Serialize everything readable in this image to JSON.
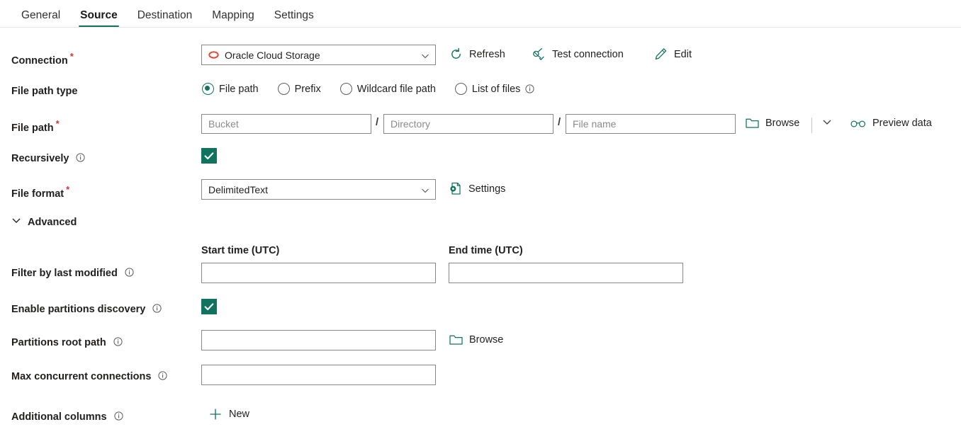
{
  "tabs": [
    {
      "label": "General",
      "active": false
    },
    {
      "label": "Source",
      "active": true
    },
    {
      "label": "Destination",
      "active": false
    },
    {
      "label": "Mapping",
      "active": false
    },
    {
      "label": "Settings",
      "active": false
    }
  ],
  "colors": {
    "accent_teal": "#107360",
    "required_red": "#d13438",
    "oracle_red": "#e8422e",
    "field_border": "#8a8886",
    "text": "#201f1e",
    "placeholder": "#8d8b89"
  },
  "connection": {
    "label": "Connection",
    "required": "*",
    "value": "Oracle Cloud Storage",
    "icon": "oracle-logo-icon",
    "refresh_label": "Refresh",
    "test_connection_label": "Test connection",
    "edit_label": "Edit"
  },
  "file_path_type": {
    "label": "File path type",
    "options": [
      {
        "label": "File path",
        "selected": true,
        "info": false
      },
      {
        "label": "Prefix",
        "selected": false,
        "info": false
      },
      {
        "label": "Wildcard file path",
        "selected": false,
        "info": false
      },
      {
        "label": "List of files",
        "selected": false,
        "info": true
      }
    ]
  },
  "file_path": {
    "label": "File path",
    "required": "*",
    "bucket_placeholder": "Bucket",
    "bucket_value": "",
    "directory_placeholder": "Directory",
    "directory_value": "",
    "filename_placeholder": "File name",
    "filename_value": "",
    "separator": "/",
    "browse_label": "Browse",
    "preview_label": "Preview data"
  },
  "recursively": {
    "label": "Recursively",
    "checked": true,
    "info": true
  },
  "file_format": {
    "label": "File format",
    "required": "*",
    "value": "DelimitedText",
    "settings_label": "Settings"
  },
  "advanced": {
    "label": "Advanced",
    "expanded": true
  },
  "filter_by_last_modified": {
    "label": "Filter by last modified",
    "info": true,
    "start_time_label": "Start time (UTC)",
    "start_time_value": "",
    "end_time_label": "End time (UTC)",
    "end_time_value": ""
  },
  "enable_partitions_discovery": {
    "label": "Enable partitions discovery",
    "checked": true,
    "info": true
  },
  "partitions_root_path": {
    "label": "Partitions root path",
    "info": true,
    "value": "",
    "browse_label": "Browse"
  },
  "max_concurrent_connections": {
    "label": "Max concurrent connections",
    "info": true,
    "value": ""
  },
  "additional_columns": {
    "label": "Additional columns",
    "info": true,
    "new_label": "New"
  }
}
